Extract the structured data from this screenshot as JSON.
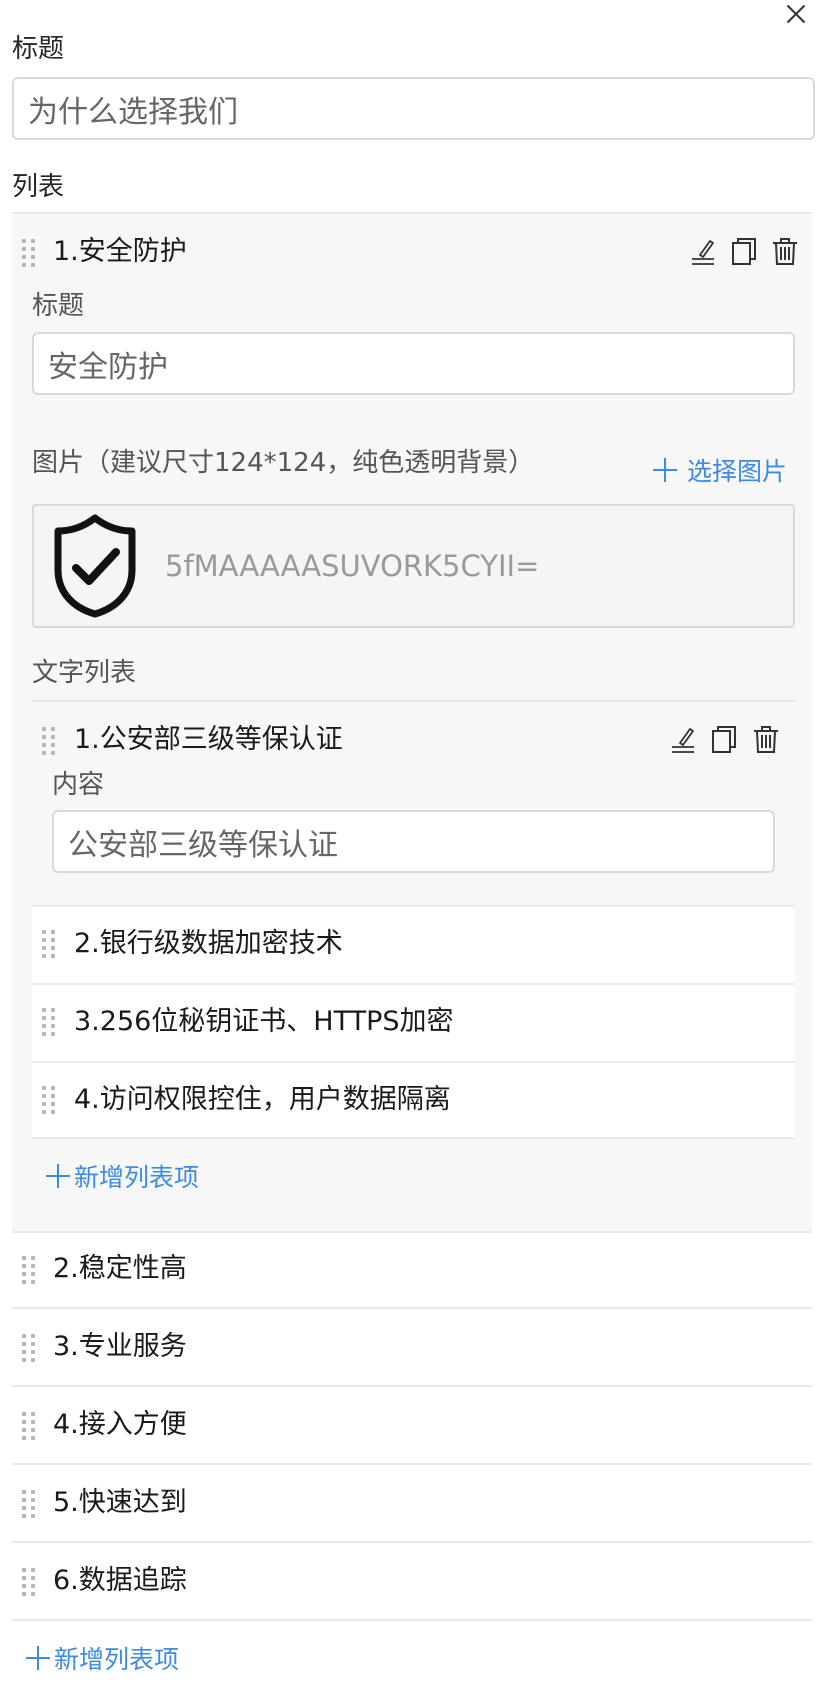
{
  "close_label": "×",
  "title_field": {
    "label": "标题",
    "value": "为什么选择我们"
  },
  "list_section": {
    "label": "列表",
    "items": [
      {
        "title": "1.安全防护",
        "fields": {
          "title_label": "标题",
          "title_value": "安全防护",
          "image_label": "图片（建议尺寸124*124，纯色透明背景）",
          "choose_image_label": "选择图片",
          "image_name": "5fMAAAAASUVORK5CYII=",
          "text_list_label": "文字列表",
          "text_items": [
            {
              "title": "1.公安部三级等保认证",
              "content_label": "内容",
              "content_value": "公安部三级等保认证"
            },
            {
              "title": "2.银行级数据加密技术"
            },
            {
              "title": "3.256位秘钥证书、HTTPS加密"
            },
            {
              "title": "4.访问权限控住，用户数据隔离"
            }
          ],
          "add_text_item_label": "新增列表项"
        }
      },
      {
        "title": "2.稳定性高"
      },
      {
        "title": "3.专业服务"
      },
      {
        "title": "4.接入方便"
      },
      {
        "title": "5.快速达到"
      },
      {
        "title": "6.数据追踪"
      }
    ],
    "add_item_label": "新增列表项"
  },
  "colors": {
    "link": "#3d8ae6",
    "panel_bg": "#f7f7f7",
    "border": "#d9d9d9"
  },
  "icons": [
    "close-icon",
    "drag-handle-icon",
    "edit-icon",
    "copy-icon",
    "delete-icon",
    "plus-icon",
    "shield-check-icon"
  ]
}
